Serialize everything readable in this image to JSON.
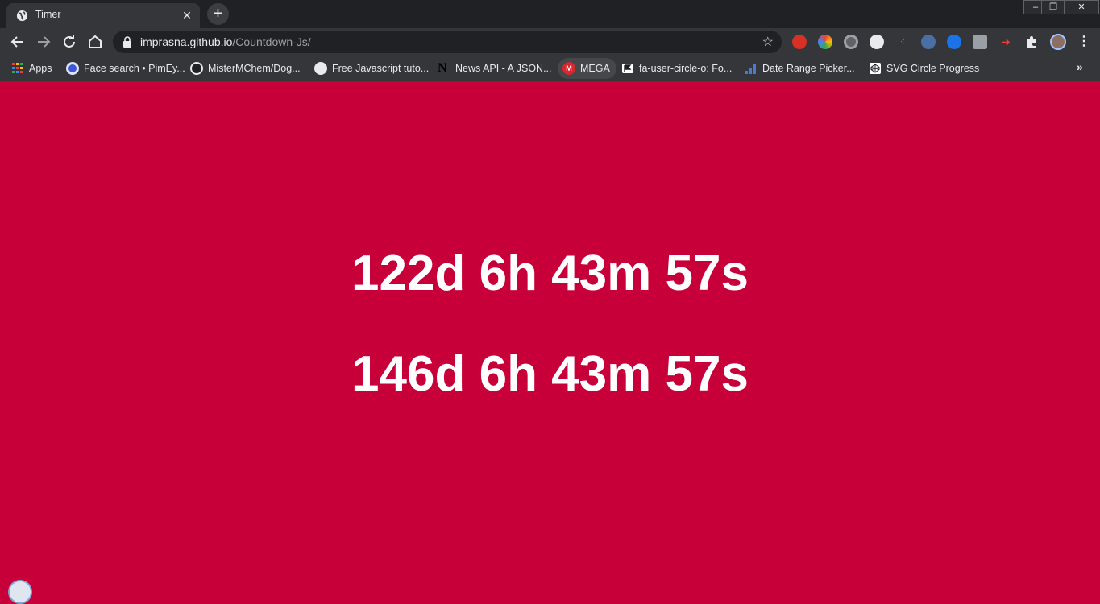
{
  "tab": {
    "title": "Timer",
    "close": "✕",
    "new_tab": "+"
  },
  "window_controls": {
    "minimize": "–",
    "restore": "❐",
    "close": "✕"
  },
  "omnibox": {
    "domain": "imprasna.github.io",
    "path": "/Countdown-Js/",
    "star": "☆"
  },
  "bookmarks": [
    {
      "label": "Apps",
      "icon": "apps-grid-icon",
      "color": "#e8a33b"
    },
    {
      "label": "Face search • PimEy...",
      "icon": "pimeyes-icon",
      "color": "#3b58d6"
    },
    {
      "label": "MisterMChem/Dog...",
      "icon": "github-icon",
      "color": "#e8eaed"
    },
    {
      "label": "Free Javascript tuto...",
      "icon": "globe-icon",
      "color": "#e8eaed"
    },
    {
      "label": "News API - A JSON...",
      "icon": "newsapi-icon",
      "color": "#000000"
    },
    {
      "label": "MEGA",
      "icon": "mega-icon",
      "color": "#d9272e"
    },
    {
      "label": "fa-user-circle-o: Fo...",
      "icon": "flag-icon",
      "color": "#ffffff"
    },
    {
      "label": "Date Range Picker...",
      "icon": "bar-chart-icon",
      "color": "#4a7bd0"
    },
    {
      "label": "SVG Circle Progress",
      "icon": "codepen-icon",
      "color": "#e8eaed"
    }
  ],
  "bookmarks_more": "»",
  "countdowns": [
    {
      "text": "122d 6h 43m 57s"
    },
    {
      "text": "146d 6h 43m 57s"
    }
  ],
  "colors": {
    "background": "#c70039",
    "text": "#ffffff",
    "chrome_dark": "#202124",
    "chrome": "#35363a"
  }
}
